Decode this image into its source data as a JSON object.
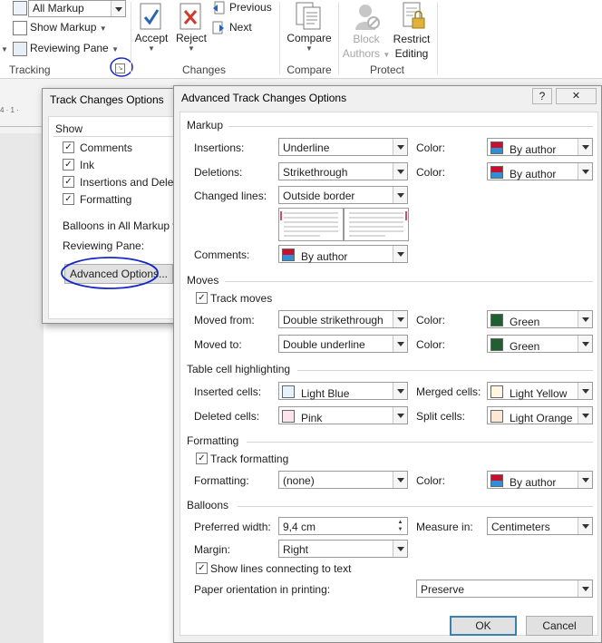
{
  "ribbon": {
    "markup_display": "All Markup",
    "show_markup": "Show Markup",
    "reviewing_pane": "Reviewing Pane",
    "tracking_group": "Tracking",
    "accept": "Accept",
    "reject": "Reject",
    "previous": "Previous",
    "next": "Next",
    "changes_group": "Changes",
    "compare": "Compare",
    "compare_group": "Compare",
    "block_authors_line1": "Block",
    "block_authors_line2": "Authors",
    "restrict_line1": "Restrict",
    "restrict_line2": "Editing",
    "protect_group": "Protect"
  },
  "tco_dialog": {
    "title": "Track Changes Options",
    "show_section": "Show",
    "show_items": [
      {
        "label": "Comments",
        "checked": true
      },
      {
        "label": "Ink",
        "checked": true
      },
      {
        "label": "Insertions and Deleti",
        "checked": true
      },
      {
        "label": "Formatting",
        "checked": true
      }
    ],
    "balloons_label": "Balloons in All Markup v",
    "reviewing_pane_label": "Reviewing Pane:",
    "advanced_button": "Advanced Options..."
  },
  "atco": {
    "title": "Advanced Track Changes Options",
    "help": "?",
    "close": "✕",
    "markup_section": "Markup",
    "insertions_label": "Insertions:",
    "insertions_value": "Underline",
    "deletions_label": "Deletions:",
    "deletions_value": "Strikethrough",
    "changed_lines_label": "Changed lines:",
    "changed_lines_value": "Outside border",
    "comments_label": "Comments:",
    "comments_value": "By author",
    "color_label": "Color:",
    "insert_color": "By author",
    "delete_color": "By author",
    "moves_section": "Moves",
    "track_moves": "Track moves",
    "moved_from_label": "Moved from:",
    "moved_from_value": "Double strikethrough",
    "moved_from_color": "Green",
    "moved_to_label": "Moved to:",
    "moved_to_value": "Double underline",
    "moved_to_color": "Green",
    "table_section": "Table cell highlighting",
    "inserted_cells_label": "Inserted cells:",
    "inserted_cells_value": "Light Blue",
    "merged_cells_label": "Merged cells:",
    "merged_cells_value": "Light Yellow",
    "deleted_cells_label": "Deleted cells:",
    "deleted_cells_value": "Pink",
    "split_cells_label": "Split cells:",
    "split_cells_value": "Light Orange",
    "formatting_section": "Formatting",
    "track_formatting": "Track formatting",
    "formatting_label": "Formatting:",
    "formatting_value": "(none)",
    "formatting_color": "By author",
    "balloons_section": "Balloons",
    "preferred_width_label": "Preferred width:",
    "preferred_width_value": "9,4 cm",
    "measure_in_label": "Measure in:",
    "measure_in_value": "Centimeters",
    "margin_label": "Margin:",
    "margin_value": "Right",
    "show_lines": "Show lines connecting to text",
    "paper_orientation_label": "Paper orientation in printing:",
    "paper_orientation_value": "Preserve",
    "ok": "OK",
    "cancel": "Cancel"
  },
  "colors": {
    "by_author_top": "#c8102e",
    "by_author_bottom": "#2f8fd6",
    "green": "#1f5f32",
    "light_blue": "#e6f2fb",
    "light_yellow": "#fff6df",
    "pink": "#fde3ea",
    "light_orange": "#fde8d4",
    "annotation_circle": "#1428c8",
    "default_button_border": "#3c7fb1"
  }
}
